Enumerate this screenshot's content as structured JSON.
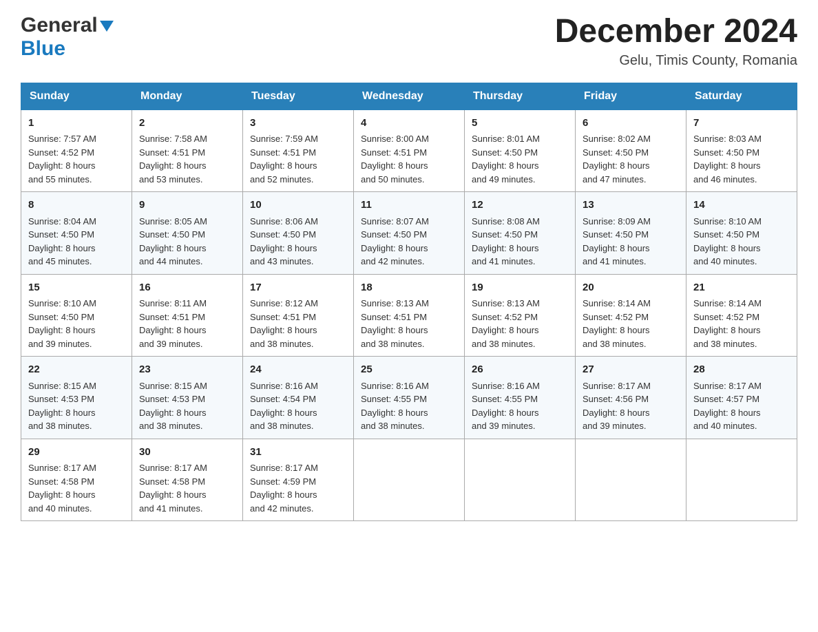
{
  "header": {
    "logo": {
      "general": "General",
      "blue": "Blue",
      "arrow": "▼"
    },
    "title": "December 2024",
    "location": "Gelu, Timis County, Romania"
  },
  "days_of_week": [
    "Sunday",
    "Monday",
    "Tuesday",
    "Wednesday",
    "Thursday",
    "Friday",
    "Saturday"
  ],
  "weeks": [
    [
      {
        "day": "1",
        "sunrise": "7:57 AM",
        "sunset": "4:52 PM",
        "daylight": "8 hours and 55 minutes."
      },
      {
        "day": "2",
        "sunrise": "7:58 AM",
        "sunset": "4:51 PM",
        "daylight": "8 hours and 53 minutes."
      },
      {
        "day": "3",
        "sunrise": "7:59 AM",
        "sunset": "4:51 PM",
        "daylight": "8 hours and 52 minutes."
      },
      {
        "day": "4",
        "sunrise": "8:00 AM",
        "sunset": "4:51 PM",
        "daylight": "8 hours and 50 minutes."
      },
      {
        "day": "5",
        "sunrise": "8:01 AM",
        "sunset": "4:50 PM",
        "daylight": "8 hours and 49 minutes."
      },
      {
        "day": "6",
        "sunrise": "8:02 AM",
        "sunset": "4:50 PM",
        "daylight": "8 hours and 47 minutes."
      },
      {
        "day": "7",
        "sunrise": "8:03 AM",
        "sunset": "4:50 PM",
        "daylight": "8 hours and 46 minutes."
      }
    ],
    [
      {
        "day": "8",
        "sunrise": "8:04 AM",
        "sunset": "4:50 PM",
        "daylight": "8 hours and 45 minutes."
      },
      {
        "day": "9",
        "sunrise": "8:05 AM",
        "sunset": "4:50 PM",
        "daylight": "8 hours and 44 minutes."
      },
      {
        "day": "10",
        "sunrise": "8:06 AM",
        "sunset": "4:50 PM",
        "daylight": "8 hours and 43 minutes."
      },
      {
        "day": "11",
        "sunrise": "8:07 AM",
        "sunset": "4:50 PM",
        "daylight": "8 hours and 42 minutes."
      },
      {
        "day": "12",
        "sunrise": "8:08 AM",
        "sunset": "4:50 PM",
        "daylight": "8 hours and 41 minutes."
      },
      {
        "day": "13",
        "sunrise": "8:09 AM",
        "sunset": "4:50 PM",
        "daylight": "8 hours and 41 minutes."
      },
      {
        "day": "14",
        "sunrise": "8:10 AM",
        "sunset": "4:50 PM",
        "daylight": "8 hours and 40 minutes."
      }
    ],
    [
      {
        "day": "15",
        "sunrise": "8:10 AM",
        "sunset": "4:50 PM",
        "daylight": "8 hours and 39 minutes."
      },
      {
        "day": "16",
        "sunrise": "8:11 AM",
        "sunset": "4:51 PM",
        "daylight": "8 hours and 39 minutes."
      },
      {
        "day": "17",
        "sunrise": "8:12 AM",
        "sunset": "4:51 PM",
        "daylight": "8 hours and 38 minutes."
      },
      {
        "day": "18",
        "sunrise": "8:13 AM",
        "sunset": "4:51 PM",
        "daylight": "8 hours and 38 minutes."
      },
      {
        "day": "19",
        "sunrise": "8:13 AM",
        "sunset": "4:52 PM",
        "daylight": "8 hours and 38 minutes."
      },
      {
        "day": "20",
        "sunrise": "8:14 AM",
        "sunset": "4:52 PM",
        "daylight": "8 hours and 38 minutes."
      },
      {
        "day": "21",
        "sunrise": "8:14 AM",
        "sunset": "4:52 PM",
        "daylight": "8 hours and 38 minutes."
      }
    ],
    [
      {
        "day": "22",
        "sunrise": "8:15 AM",
        "sunset": "4:53 PM",
        "daylight": "8 hours and 38 minutes."
      },
      {
        "day": "23",
        "sunrise": "8:15 AM",
        "sunset": "4:53 PM",
        "daylight": "8 hours and 38 minutes."
      },
      {
        "day": "24",
        "sunrise": "8:16 AM",
        "sunset": "4:54 PM",
        "daylight": "8 hours and 38 minutes."
      },
      {
        "day": "25",
        "sunrise": "8:16 AM",
        "sunset": "4:55 PM",
        "daylight": "8 hours and 38 minutes."
      },
      {
        "day": "26",
        "sunrise": "8:16 AM",
        "sunset": "4:55 PM",
        "daylight": "8 hours and 39 minutes."
      },
      {
        "day": "27",
        "sunrise": "8:17 AM",
        "sunset": "4:56 PM",
        "daylight": "8 hours and 39 minutes."
      },
      {
        "day": "28",
        "sunrise": "8:17 AM",
        "sunset": "4:57 PM",
        "daylight": "8 hours and 40 minutes."
      }
    ],
    [
      {
        "day": "29",
        "sunrise": "8:17 AM",
        "sunset": "4:58 PM",
        "daylight": "8 hours and 40 minutes."
      },
      {
        "day": "30",
        "sunrise": "8:17 AM",
        "sunset": "4:58 PM",
        "daylight": "8 hours and 41 minutes."
      },
      {
        "day": "31",
        "sunrise": "8:17 AM",
        "sunset": "4:59 PM",
        "daylight": "8 hours and 42 minutes."
      },
      null,
      null,
      null,
      null
    ]
  ],
  "labels": {
    "sunrise": "Sunrise:",
    "sunset": "Sunset:",
    "daylight": "Daylight:"
  }
}
